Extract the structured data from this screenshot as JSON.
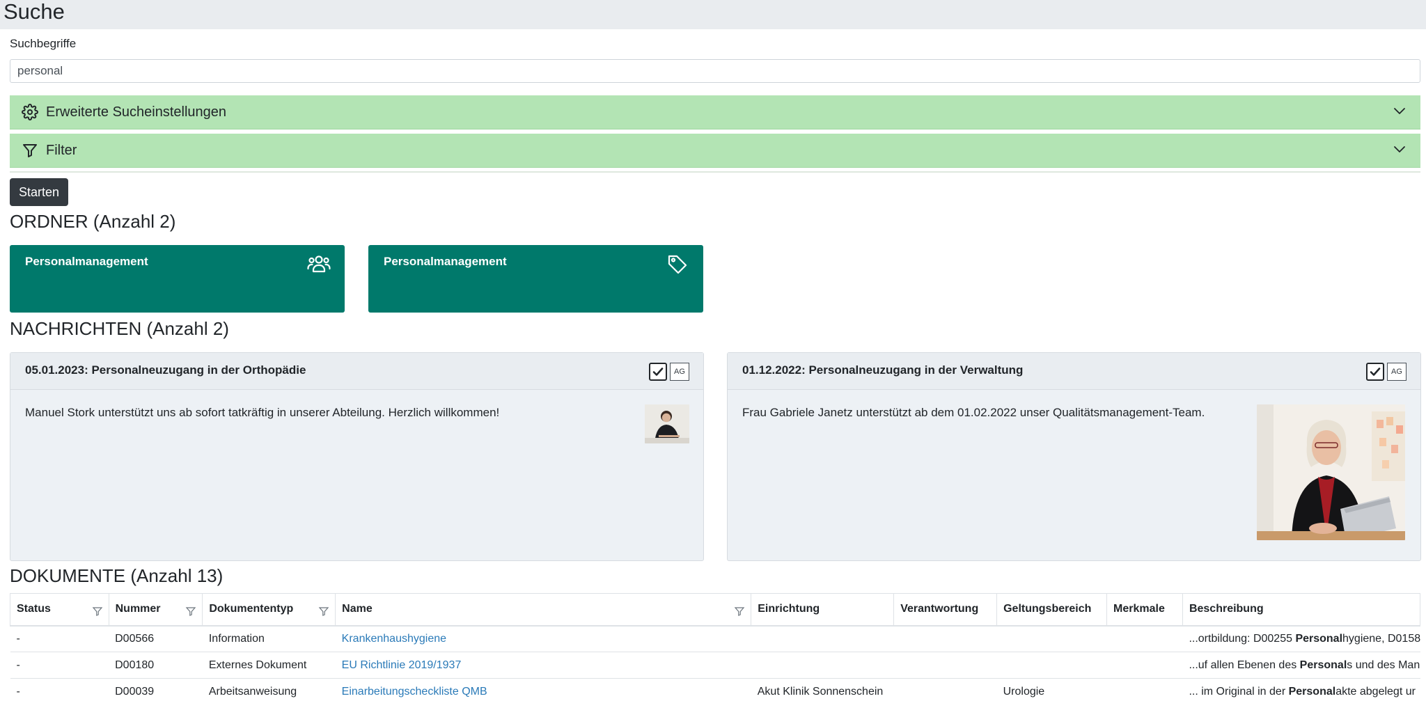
{
  "page": {
    "title": "Suche"
  },
  "search": {
    "label": "Suchbegriffe",
    "value": "personal"
  },
  "accordions": {
    "advanced": {
      "label": "Erweiterte Sucheinstellungen",
      "icon": "gear-icon"
    },
    "filter": {
      "label": "Filter",
      "icon": "funnel-icon"
    }
  },
  "start_button": {
    "label": "Starten"
  },
  "sections": {
    "ordner": "ORDNER (Anzahl 2)",
    "nachrichten": "NACHRICHTEN (Anzahl 2)",
    "dokumente": "DOKUMENTE (Anzahl 13)"
  },
  "folders": [
    {
      "title": "Personalmanagement",
      "icon": "users-icon"
    },
    {
      "title": "Personalmanagement",
      "icon": "tag-icon"
    }
  ],
  "news": [
    {
      "title": "05.01.2023: Personalneuzugang in der Orthopädie",
      "text": "Manuel Stork unterstützt uns ab sofort tatkräftig in unserer Abteilung. Herzlich willkommen!",
      "badge": "AG"
    },
    {
      "title": "01.12.2022: Personalneuzugang in der Verwaltung",
      "text": "Frau Gabriele Janetz unterstützt ab dem 01.02.2022 unser Qualitätsmanagement-Team.",
      "badge": "AG"
    }
  ],
  "documents": {
    "columns": [
      "Status",
      "Nummer",
      "Dokumententyp",
      "Name",
      "Einrichtung",
      "Verantwortung",
      "Geltungsbereich",
      "Merkmale",
      "Beschreibung"
    ],
    "rows": [
      {
        "status": "-",
        "nummer": "D00566",
        "typ": "Information",
        "name": "Krankenhaushygiene",
        "einrichtung": "",
        "verantwortung": "",
        "geltungsbereich": "",
        "merkmale": "",
        "desc_pre": "...ortbildung: D00255 ",
        "desc_bold": "Personal",
        "desc_post": "hygiene, D0158"
      },
      {
        "status": "-",
        "nummer": "D00180",
        "typ": "Externes Dokument",
        "name": "EU Richtlinie 2019/1937",
        "einrichtung": "",
        "verantwortung": "",
        "geltungsbereich": "",
        "merkmale": "",
        "desc_pre": "...uf allen Ebenen des ",
        "desc_bold": "Personal",
        "desc_post": "s und des Man"
      },
      {
        "status": "-",
        "nummer": "D00039",
        "typ": "Arbeitsanweisung",
        "name": "Einarbeitungscheckliste QMB",
        "einrichtung": "Akut Klinik Sonnenschein",
        "verantwortung": "",
        "geltungsbereich": "Urologie",
        "merkmale": "",
        "desc_pre": "... im Original in der ",
        "desc_bold": "Personal",
        "desc_post": "akte abgelegt ur"
      }
    ]
  },
  "colors": {
    "accent_green": "#b3e4b4",
    "folder_teal": "#00796b",
    "link_blue": "#2a7ab8",
    "dark_button": "#343a40"
  }
}
